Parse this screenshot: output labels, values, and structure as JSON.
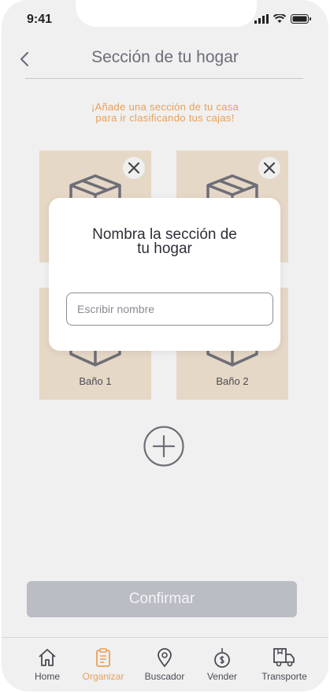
{
  "status_bar": {
    "time": "9:41"
  },
  "header": {
    "title": "Sección de tu hogar"
  },
  "subtitle": "¡Añade una sección de tu casa\npara ir clasificando tus cajas!",
  "sections": [
    {
      "label": ""
    },
    {
      "label": ""
    },
    {
      "label": "Baño 1"
    },
    {
      "label": "Baño 2"
    }
  ],
  "modal": {
    "title": "Nombra la sección de\ntu hogar",
    "input_placeholder": "Escribir nombre",
    "input_value": ""
  },
  "confirm_label": "Confirmar",
  "tabs": [
    {
      "label": "Home",
      "icon": "home-icon",
      "active": false
    },
    {
      "label": "Organizar",
      "icon": "clipboard-icon",
      "active": true
    },
    {
      "label": "Buscador",
      "icon": "location-pin-icon",
      "active": false
    },
    {
      "label": "Vender",
      "icon": "price-tag-icon",
      "active": false
    },
    {
      "label": "Transporte",
      "icon": "truck-icon",
      "active": false
    }
  ],
  "colors": {
    "accent": "#e8a05b",
    "card": "#e6d8c6",
    "background": "#f0f0f0",
    "button_disabled": "#babdc4"
  }
}
